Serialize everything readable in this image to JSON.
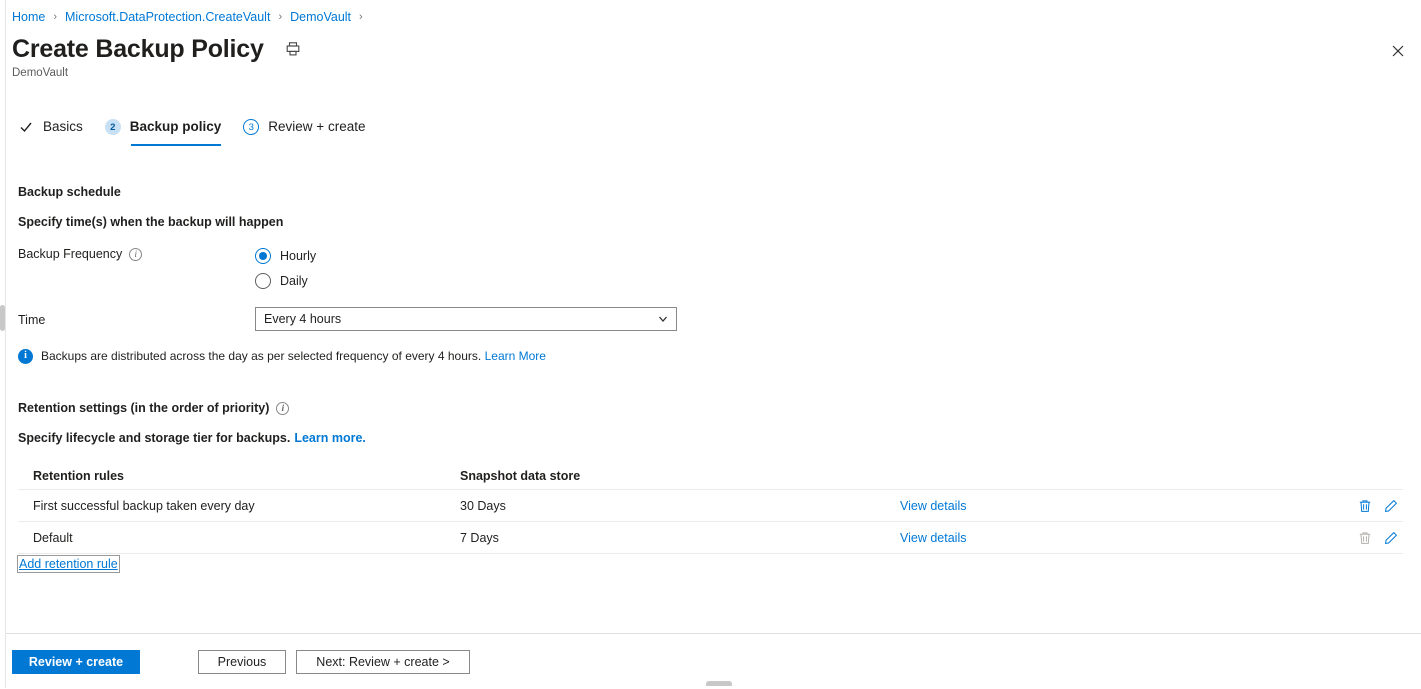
{
  "breadcrumb": {
    "items": [
      "Home",
      "Microsoft.DataProtection.CreateVault",
      "DemoVault"
    ],
    "separator": "›",
    "trailing_separator": "›"
  },
  "header": {
    "title": "Create Backup Policy",
    "subtitle": "DemoVault",
    "print_icon": "printer-icon",
    "close_icon": "close-icon"
  },
  "wizard": {
    "steps": [
      {
        "badge": "✓",
        "label": "Basics",
        "state": "completed"
      },
      {
        "badge": "2",
        "label": "Backup policy",
        "state": "active"
      },
      {
        "badge": "3",
        "label": "Review + create",
        "state": "upcoming"
      }
    ]
  },
  "schedule": {
    "heading": "Backup schedule",
    "subheading": "Specify time(s) when the backup will happen",
    "frequency_label": "Backup Frequency",
    "frequency_info_icon": "info-icon",
    "frequency_options": [
      {
        "label": "Hourly",
        "selected": true
      },
      {
        "label": "Daily",
        "selected": false
      }
    ],
    "time_label": "Time",
    "time_value": "Every 4 hours",
    "time_chevron_icon": "chevron-down-icon",
    "info_icon": "info-filled-icon",
    "info_message": "Backups are distributed across the day as per selected frequency of every 4 hours.",
    "info_link": "Learn More"
  },
  "retention": {
    "heading": "Retention settings (in the order of priority)",
    "heading_info_icon": "info-icon",
    "subheading": "Specify lifecycle and storage tier for backups.",
    "subheading_link": "Learn more.",
    "columns": [
      "Retention rules",
      "Snapshot data store"
    ],
    "rows": [
      {
        "rule": "First successful backup taken every day",
        "store": "30 Days",
        "view_details": "View details",
        "delete_icon": "trash-icon",
        "delete_enabled": true,
        "edit_icon": "pencil-icon",
        "edit_enabled": true
      },
      {
        "rule": "Default",
        "store": "7 Days",
        "view_details": "View details",
        "delete_icon": "trash-icon",
        "delete_enabled": false,
        "edit_icon": "pencil-icon",
        "edit_enabled": true
      }
    ],
    "add_rule_label": "Add retention rule"
  },
  "footer": {
    "review_create": "Review + create",
    "previous": "Previous",
    "next": "Next: Review + create >"
  },
  "colors": {
    "accent": "#0078d4",
    "link": "#0078d4",
    "text": "#201f1e",
    "muted": "#605e5c",
    "border": "#8a8886",
    "row_divider": "#edebe9",
    "step_active_bg": "#c7e0f4",
    "disabled_icon": "#b3b0ad"
  }
}
